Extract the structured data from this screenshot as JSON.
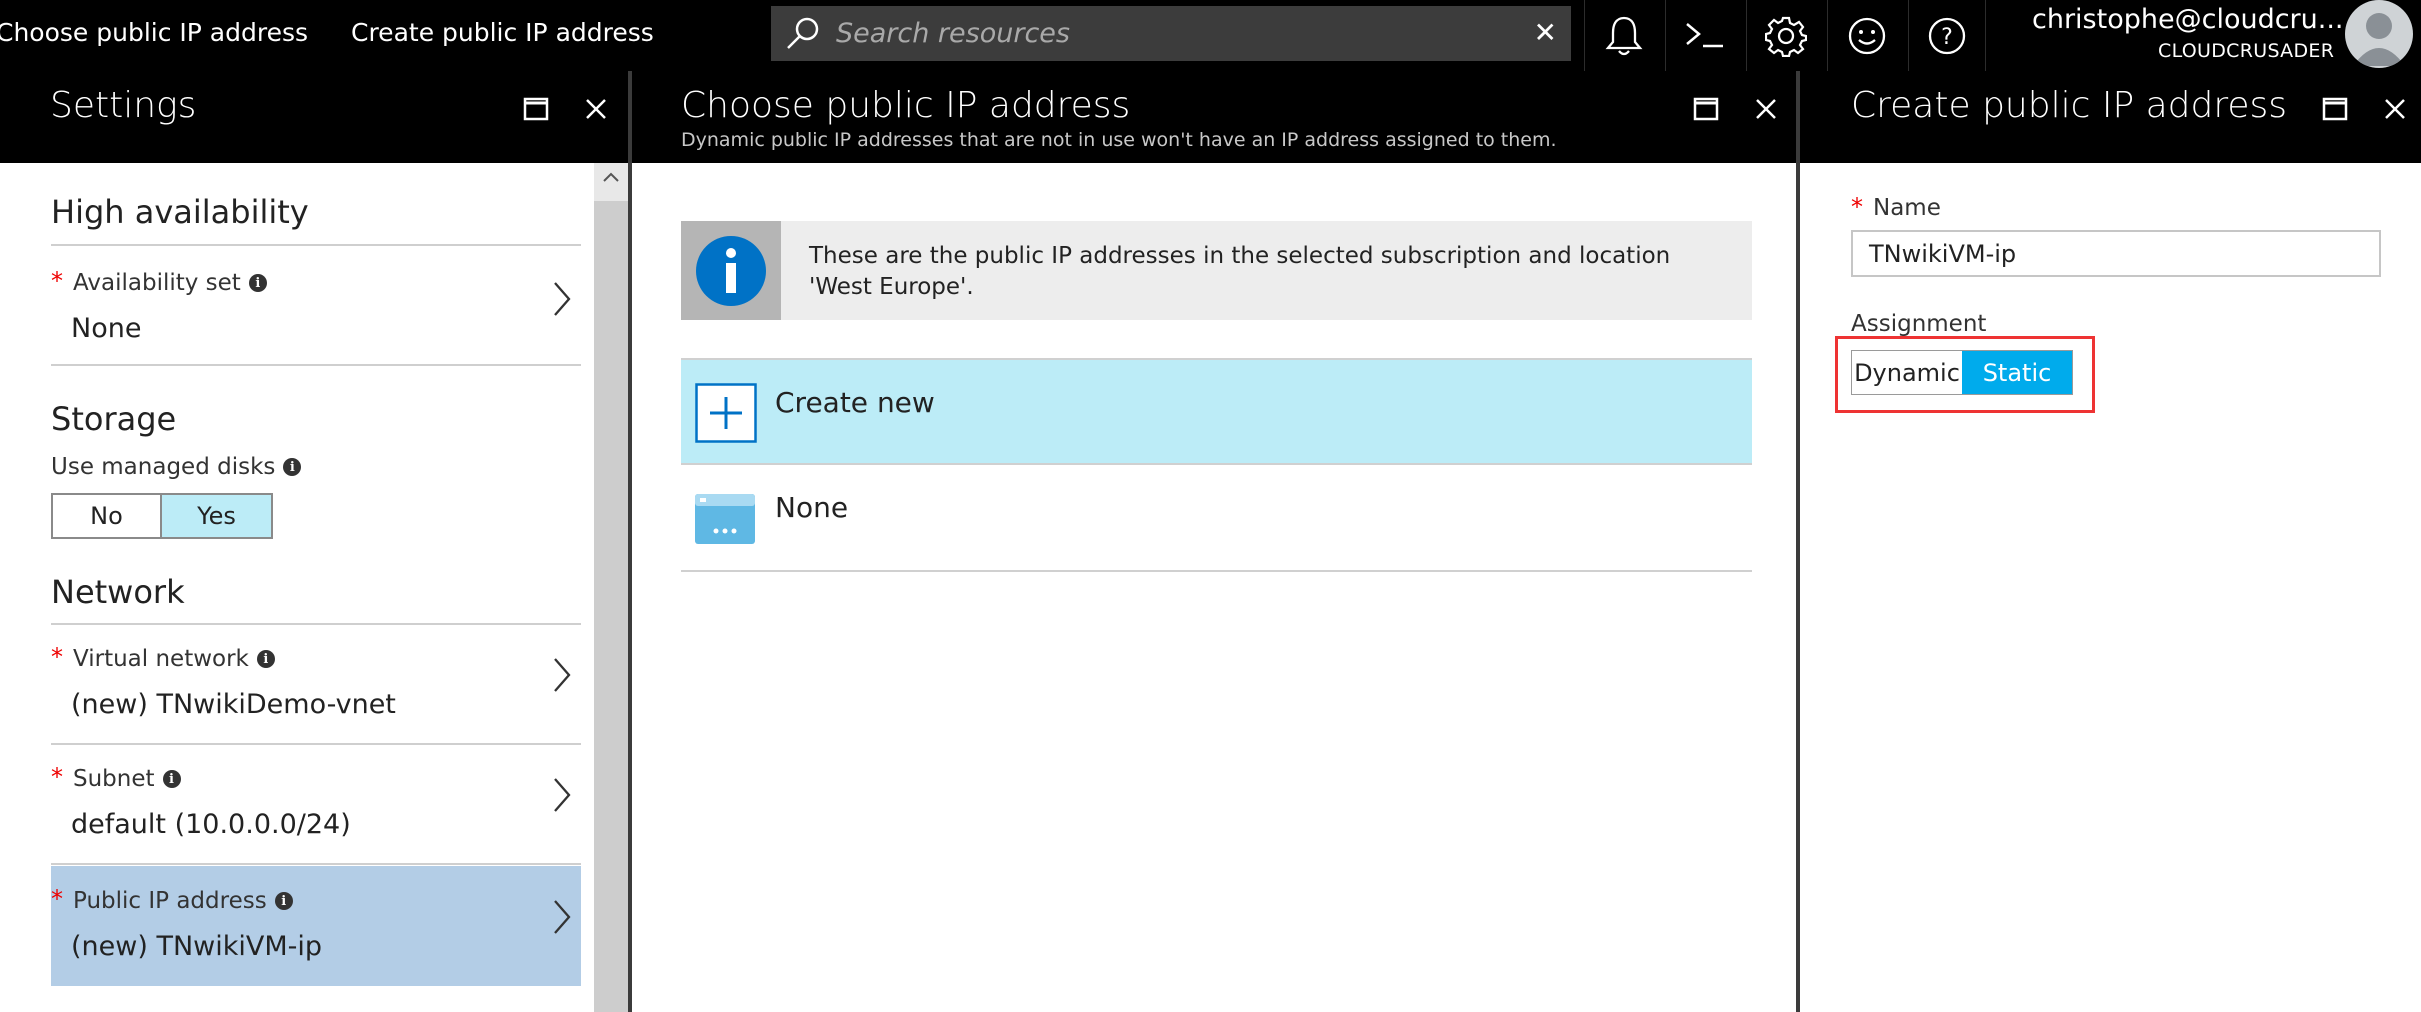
{
  "topbar": {
    "breadcrumbs": [
      "Choose public IP address",
      "Create public IP address"
    ],
    "search_placeholder": "Search resources",
    "icons": [
      "bell-icon",
      "cloud-shell-icon",
      "gear-icon",
      "smiley-icon",
      "help-icon"
    ],
    "user_email": "christophe@cloudcru...",
    "user_org": "CLOUDCRUSADER"
  },
  "settings": {
    "title": "Settings",
    "high_availability": {
      "title": "High availability",
      "availability_set_label": "Availability set",
      "availability_set_value": "None"
    },
    "storage": {
      "title": "Storage",
      "managed_disks_label": "Use managed disks",
      "options": [
        "No",
        "Yes"
      ],
      "selected": "Yes"
    },
    "network": {
      "title": "Network",
      "virtual_network_label": "Virtual network",
      "virtual_network_value": "(new) TNwikiDemo-vnet",
      "subnet_label": "Subnet",
      "subnet_value": "default (10.0.0.0/24)",
      "public_ip_label": "Public IP address",
      "public_ip_value": "(new) TNwikiVM-ip"
    }
  },
  "choose": {
    "title": "Choose public IP address",
    "subtitle": "Dynamic public IP addresses that are not in use won't have an IP address assigned to them.",
    "info_text": "These are the public IP addresses in the selected subscription and location 'West Europe'.",
    "create_new_label": "Create new",
    "none_label": "None"
  },
  "create": {
    "title": "Create public IP address",
    "name_label": "Name",
    "name_value": "TNwikiVM-ip",
    "assignment_label": "Assignment",
    "options": [
      "Dynamic",
      "Static"
    ],
    "selected": "Static"
  },
  "colors": {
    "accent": "#00abec",
    "selected_row": "#b3cde6",
    "create_new_row": "#bcecf7",
    "header_bg": "#000000",
    "required": "#ee0000"
  }
}
